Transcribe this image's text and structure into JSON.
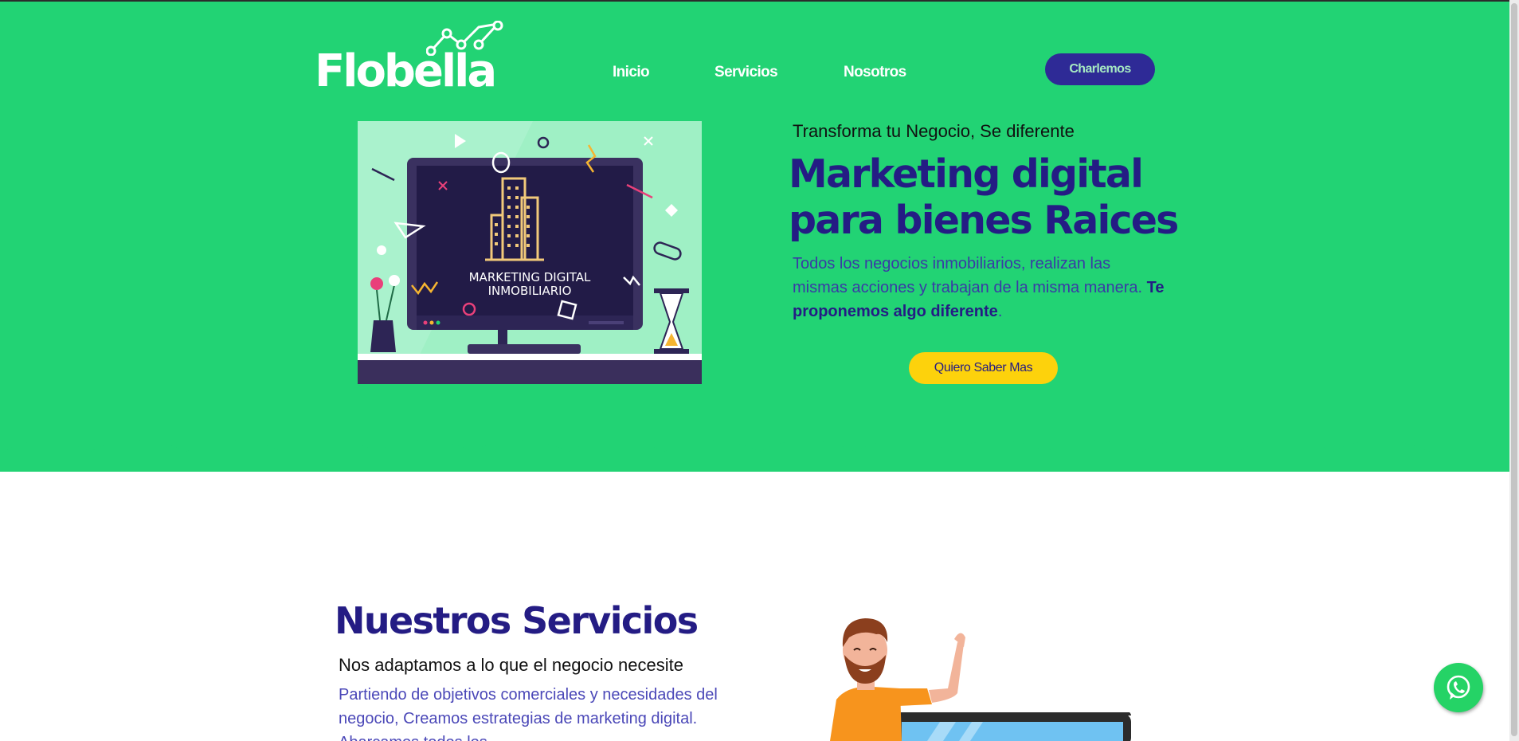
{
  "brand": {
    "name": "Flobella",
    "colors": {
      "green": "#22d374",
      "navy": "#241c84",
      "button_purple": "#2e2a96",
      "yellow": "#fdd20c",
      "whatsapp": "#25d366"
    }
  },
  "nav": {
    "items": [
      {
        "label": "Inicio"
      },
      {
        "label": "Servicios"
      },
      {
        "label": "Nosotros"
      }
    ],
    "cta_label": "Charlemos"
  },
  "hero": {
    "illustration_caption_line1": "MARKETING DIGITAL",
    "illustration_caption_line2": "INMOBILIARIO",
    "tagline": "Transforma tu Negocio, Se diferente",
    "title_line1": "Marketing digital",
    "title_line2": "para bienes Raices",
    "desc_text": "Todos los negocios inmobiliarios, realizan las mismas acciones y trabajan de la misma manera. ",
    "desc_strong": "Te proponemos algo diferente",
    "desc_end": ".",
    "cta_label": "Quiero Saber Mas"
  },
  "services": {
    "title": "Nuestros Servicios",
    "subtitle": "Nos adaptamos a lo que el negocio necesite",
    "description": "Partiendo de objetivos comerciales y necesidades del negocio, Creamos estrategias de marketing digital. Abarcamos todos los"
  },
  "icons": {
    "whatsapp": "whatsapp-icon",
    "logo_graph": "line-graph-icon"
  }
}
